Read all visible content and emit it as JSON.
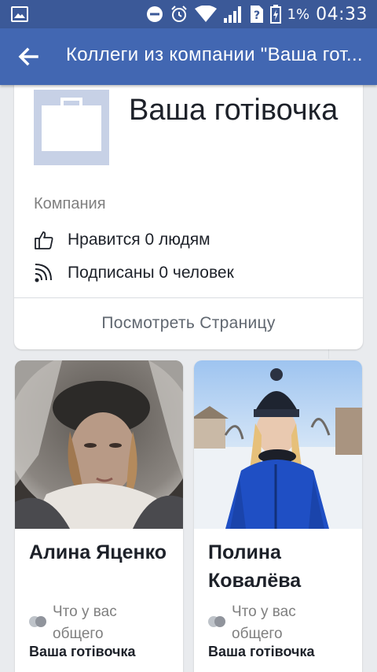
{
  "status_bar": {
    "battery_percent": "1%",
    "time": "04:33",
    "icons": [
      "image-notification-icon",
      "do-not-disturb-icon",
      "alarm-icon",
      "wifi-icon",
      "signal-icon",
      "sim-unknown-icon",
      "battery-icon"
    ]
  },
  "header": {
    "title": "Коллеги из компании \"Ваша готівочка\"",
    "back_icon": "arrow-left-icon"
  },
  "company": {
    "name": "Ваша готівочка",
    "category": "Компания",
    "likes_text": "Нравится 0 людям",
    "followers_text": "Подписаны 0 человек",
    "view_page_label": "Посмотреть Страницу"
  },
  "people": [
    {
      "name": "Алина Яценко",
      "mutual_label": "Что у вас общего",
      "mutual_company": "Ваша готівочка"
    },
    {
      "name": "Полина Ковалёва",
      "mutual_label": "Что у вас общего",
      "mutual_company": "Ваша готівочка"
    }
  ],
  "colors": {
    "status_bar": "#3b5998",
    "app_bar": "#4267b2",
    "background": "#e9ebee",
    "logo_placeholder": "#c7d1e6"
  }
}
